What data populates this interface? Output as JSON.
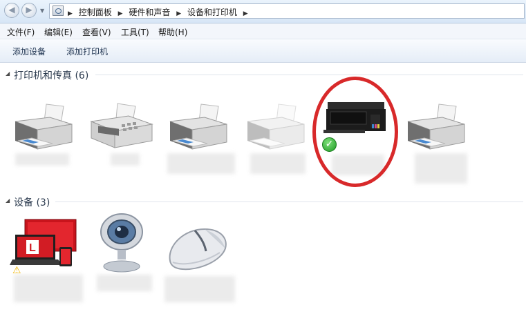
{
  "address_bar": {
    "back_icon": "back-arrow-icon",
    "forward_icon": "forward-arrow-icon",
    "breadcrumbs": [
      "控制面板",
      "硬件和声音",
      "设备和打印机"
    ]
  },
  "menu": [
    "文件(F)",
    "编辑(E)",
    "查看(V)",
    "工具(T)",
    "帮助(H)"
  ],
  "toolbar": {
    "add_device": "添加设备",
    "add_printer": "添加打印机"
  },
  "groups": {
    "printers": {
      "title": "打印机和传真 (6)"
    },
    "devices": {
      "title": "设备 (3)"
    }
  },
  "printers": [
    {
      "icon": "printer-icon"
    },
    {
      "icon": "fax-icon"
    },
    {
      "icon": "printer-icon"
    },
    {
      "icon": "printer-faded-icon"
    },
    {
      "icon": "inkjet-printer-icon",
      "default": true,
      "highlighted": true
    },
    {
      "icon": "printer-icon"
    }
  ],
  "devices": [
    {
      "icon": "laptop-monitor-icon",
      "warning": true
    },
    {
      "icon": "webcam-icon"
    },
    {
      "icon": "mouse-icon"
    }
  ],
  "colors": {
    "highlight_circle": "#d8292a",
    "default_check": "#1e9a24",
    "warning": "#f2b705"
  }
}
